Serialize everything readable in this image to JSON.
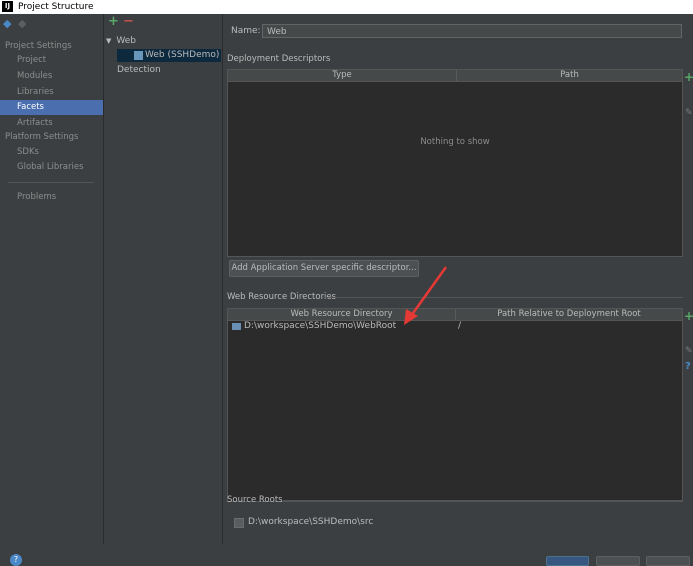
{
  "window": {
    "title": "Project Structure",
    "app_icon": "IJ"
  },
  "left_nav": {
    "sections": [
      {
        "header": "Project Settings",
        "items": [
          "Project",
          "Modules",
          "Libraries",
          "Facets",
          "Artifacts"
        ]
      },
      {
        "header": "Platform Settings",
        "items": [
          "SDKs",
          "Global Libraries"
        ]
      }
    ],
    "extra": [
      "Problems"
    ],
    "selected": "Facets"
  },
  "facet_tree": {
    "root": "Web",
    "child": "Web (SSHDemo)",
    "detection": "Detection"
  },
  "panel": {
    "name_label": "Name:",
    "name_value": "Web",
    "deployment": {
      "title": "Deployment Descriptors",
      "columns": [
        "Type",
        "Path"
      ],
      "empty_text": "Nothing to show",
      "add_button": "Add Application Server specific descriptor..."
    },
    "web_resources": {
      "title": "Web Resource Directories",
      "columns": [
        "Web Resource Directory",
        "Path Relative to Deployment Root"
      ],
      "rows": [
        {
          "directory": "D:\\workspace\\SSHDemo\\WebRoot",
          "path": "/"
        }
      ]
    },
    "source_roots": {
      "title": "Source Roots",
      "items": [
        {
          "path": "D:\\workspace\\SSHDemo\\src",
          "checked": false
        }
      ]
    }
  },
  "colors": {
    "accent": "#4b6eaf",
    "add": "#59a869",
    "remove": "#c75450",
    "annotation": "#e53935"
  }
}
